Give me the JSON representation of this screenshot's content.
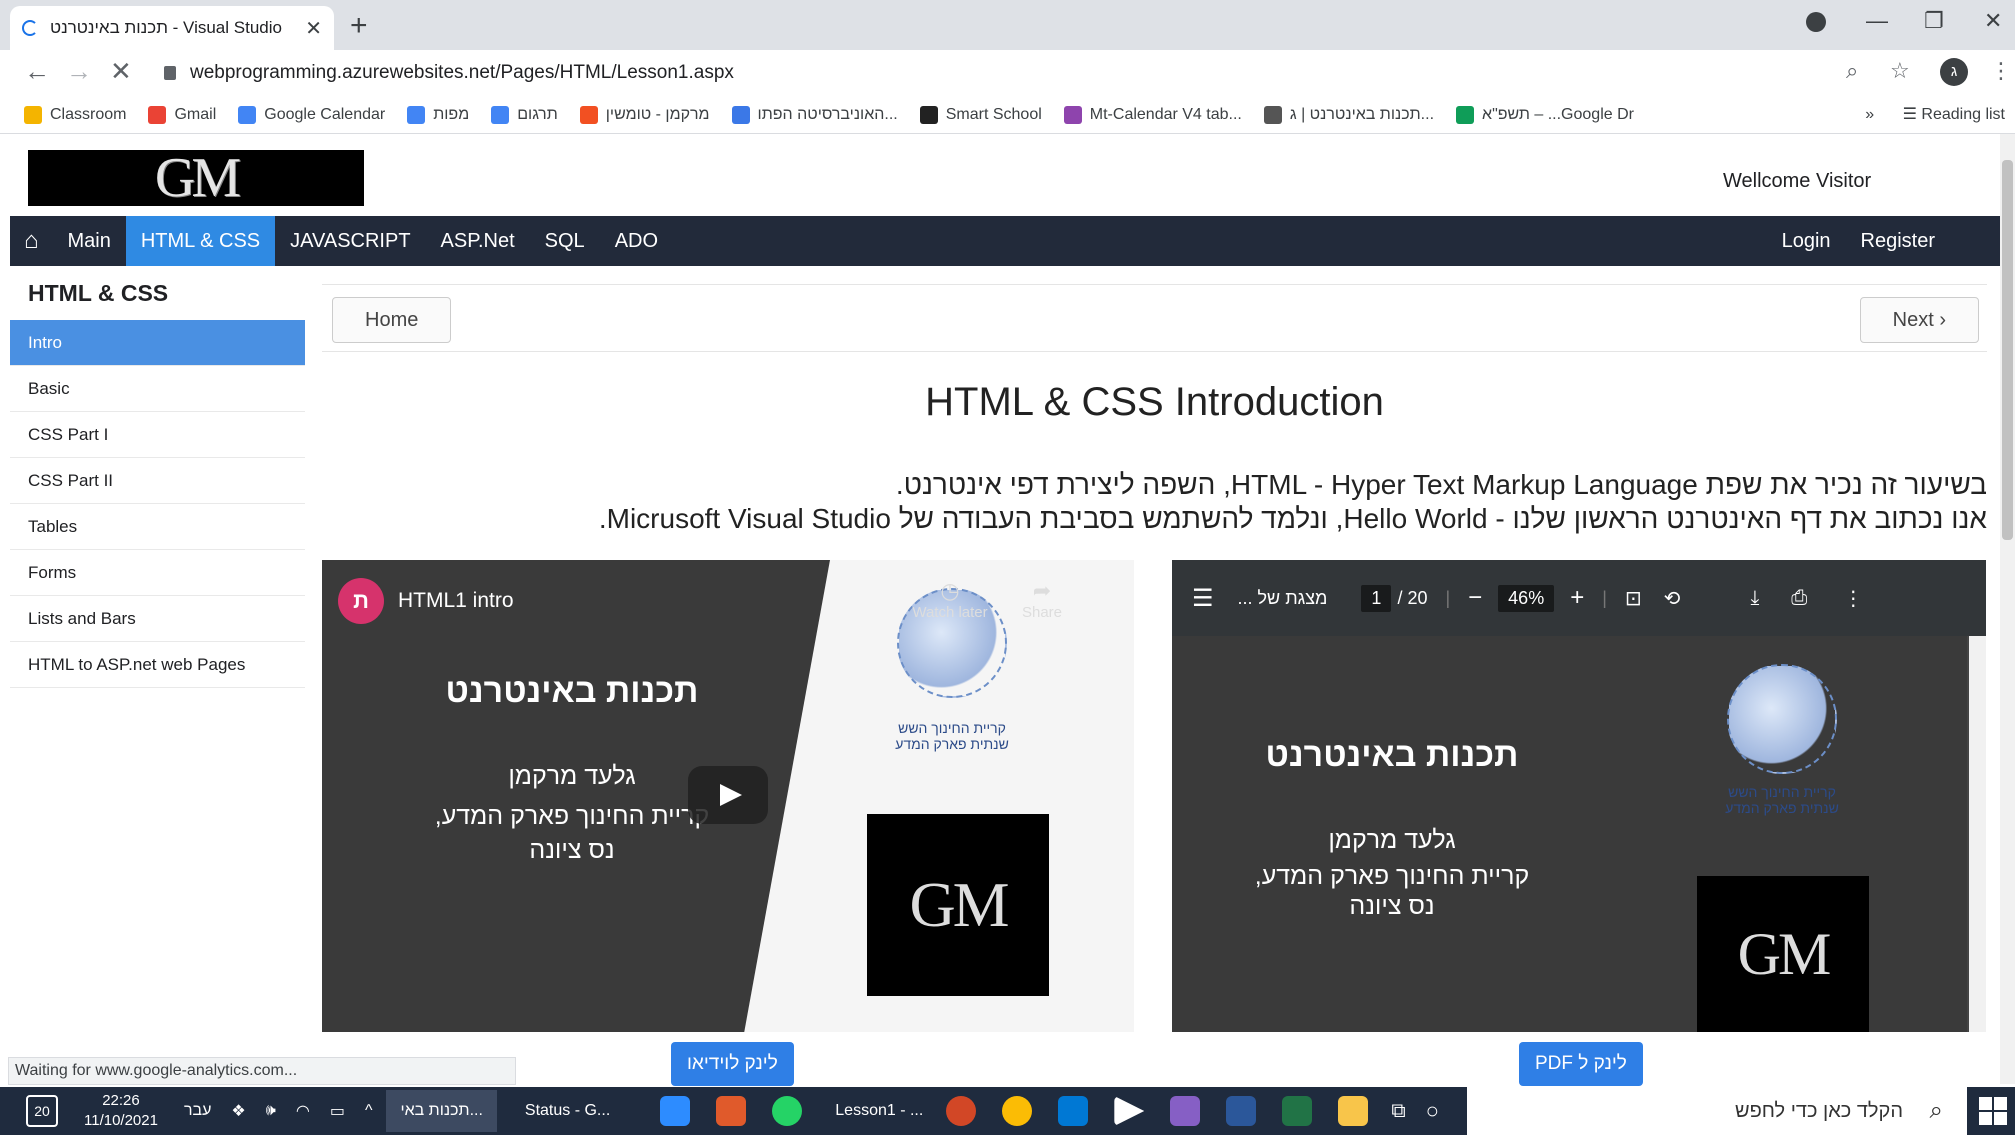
{
  "browser": {
    "tab_title": "תכנות באינטרנט - Visual Studio",
    "url": "webprogramming.azurewebsites.net/Pages/HTML/Lesson1.aspx",
    "profile_initial": "ג",
    "bookmarks": [
      {
        "label": "Classroom",
        "color": "#f4b400"
      },
      {
        "label": "Gmail",
        "color": "#ea4335"
      },
      {
        "label": "Google Calendar",
        "color": "#4285f4"
      },
      {
        "label": "מפות",
        "color": "#4285f4"
      },
      {
        "label": "תרגום",
        "color": "#4285f4"
      },
      {
        "label": "מרקמן - טומשין",
        "color": "#f25022"
      },
      {
        "label": "האוניברסיטה הפתו...",
        "color": "#3b78e7"
      },
      {
        "label": "Smart School",
        "color": "#222222"
      },
      {
        "label": "Mt-Calendar V4 tab...",
        "color": "#8e44ad"
      },
      {
        "label": "תכנות באינטרנט | ג...",
        "color": "#555555"
      },
      {
        "label": "תשפ\"א – ...Google Dr",
        "color": "#0f9d58"
      }
    ],
    "more_bookmarks": "»",
    "reading_list": "Reading list",
    "status_text": "Waiting for www.google-analytics.com..."
  },
  "site": {
    "logo": "GM",
    "welcome": "Wellcome Visitor",
    "nav": [
      "Main",
      "HTML & CSS",
      "JAVASCRIPT",
      "ASP.Net",
      "SQL",
      "ADO"
    ],
    "nav_right": [
      "Login",
      "Register"
    ],
    "sidebar_title": "HTML & CSS",
    "sidebar_items": [
      "Intro",
      "Basic",
      "CSS Part I",
      "CSS Part II",
      "Tables",
      "Forms",
      "Lists and Bars",
      "HTML to ASP.net web Pages"
    ],
    "home_button": "Home",
    "next_button": "Next ›",
    "heading": "HTML & CSS Introduction",
    "para1": "בשיעור זה נכיר את שפת HTML - Hyper Text Markup Language, השפה ליצירת דפי אינטרנט.",
    "para2": "אנו נכתוב את דף האינטרנט הראשון שלנו - Hello World, ונלמד להשתמש בסביבת העבודה של Micrusoft Visual Studio."
  },
  "video": {
    "channel_initial": "ת",
    "title": "HTML1 intro",
    "watch_later": "Watch later",
    "share": "Share",
    "link_button": "לינק לוידיאו"
  },
  "pdf": {
    "title": "מצגת של ...",
    "page": "1",
    "pages": "/ 20",
    "zoom": "46%",
    "link_button": "לינק ל PDF"
  },
  "slide": {
    "title": "תכנות באינטרנט",
    "author": "גלעד מרקמן",
    "school": "קריית החינוך פארק המדע,",
    "city": "נס ציונה",
    "globe_text": "קריית החינוך השש שנתית פארק המדע",
    "logo": "GM"
  },
  "taskbar": {
    "time": "22:26",
    "date": "11/10/2021",
    "lang": "עבר",
    "notif_count": "20",
    "search_placeholder": "הקלד כאן כדי לחפש",
    "apps": [
      "תכנות באי...",
      "Status - G...",
      "Lesson1 - ..."
    ]
  }
}
